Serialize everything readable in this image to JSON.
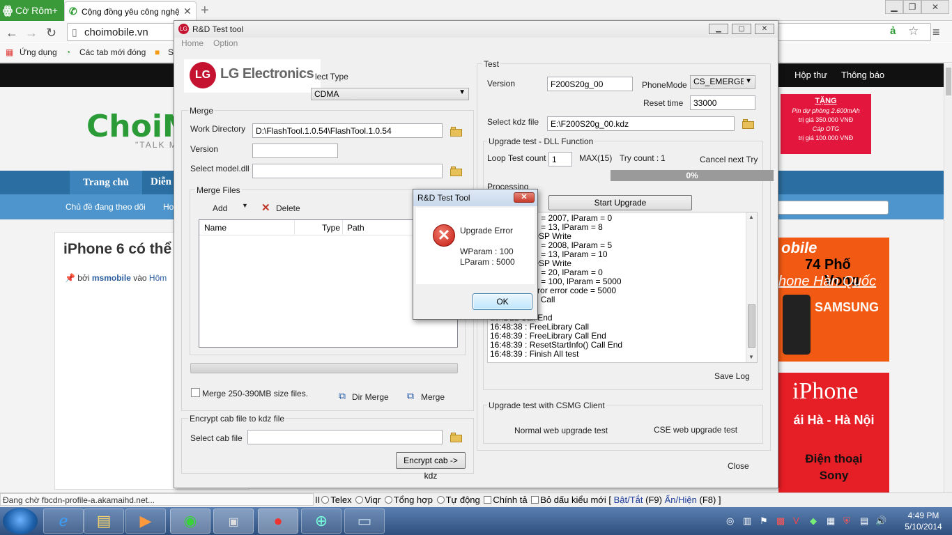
{
  "browser": {
    "brand": "Cờ Rôm+",
    "tab_title": "Cộng đồng yêu công nghệ",
    "url": "choimobile.vn",
    "bookmarks": [
      "Ứng dụng",
      "Các tab mới đóng",
      "S"
    ],
    "status": "Đang chờ fbcdn-profile-a.akamaihd.net..."
  },
  "site": {
    "topbar_links": [
      "Hộp thư",
      "Thông báo"
    ],
    "logo": "ChoiMob",
    "slogan": "\"TALK M",
    "ad_top": [
      "TẶNG",
      "Pin dự phòng 2.600mAh",
      "trị giá 350.000 VNĐ",
      "Cáp OTG",
      "trị giá 100.000 VNĐ"
    ],
    "nav_active": "Trang chủ",
    "nav_second": "Diễn",
    "subnav": [
      "Chủ đề đang theo dõi",
      "Ho"
    ],
    "post_title": "iPhone 6 có thể",
    "post_meta_prefix": "bởi",
    "post_author": "msmobile",
    "post_meta_mid": "vào",
    "post_meta_link": "Hôm",
    "ad_mid": [
      "obile",
      "74",
      "Phố Vọng",
      "hone Hàn Quốc",
      "SAMSUNG"
    ],
    "ad_low": [
      "iPhone",
      "ái Hà - Hà Nội",
      "Điện thoại",
      "Sony"
    ]
  },
  "ime": {
    "prefix": "II",
    "options": [
      "Telex",
      "Viqr",
      "Tổng hợp",
      "Tự động"
    ],
    "checks": [
      "Chính tả",
      "Bỏ dấu kiểu mới"
    ],
    "toggle_prefix": "[",
    "toggle": "Bật/Tắt",
    "toggle_key": "(F9)",
    "showhide": "Ẩn/Hiện",
    "showhide_key": "(F8) ]"
  },
  "taskbar": {
    "clock_time": "4:49 PM",
    "clock_date": "5/10/2014"
  },
  "tool": {
    "title": "R&D Test tool",
    "menu": [
      "Home",
      "Option"
    ],
    "logo_text": "LG Electronics",
    "select_type_label": "lect Type",
    "select_type_value": "CDMA",
    "merge": {
      "group": "Merge",
      "work_dir_label": "Work Directory",
      "work_dir_value": "D:\\FlashTool.1.0.54\\FlashTool.1.0.54",
      "version_label": "Version",
      "version_value": "",
      "model_label": "Select model.dll",
      "model_value": "",
      "files_group": "Merge Files",
      "add": "Add",
      "delete": "Delete",
      "columns": [
        "Name",
        "Type",
        "Path"
      ],
      "size_check": "Merge 250-390MB size files.",
      "dir_merge": "Dir Merge",
      "merge": "Merge"
    },
    "encrypt": {
      "group": "Encrypt cab file to kdz file",
      "cab_label": "Select cab file",
      "cab_value": "",
      "button": "Encrypt cab -> kdz"
    },
    "test": {
      "group": "Test",
      "version_label": "Version",
      "version_value": "F200S20g_00",
      "phonemode_label": "PhoneMode",
      "phonemode_value": "CS_EMERGEN",
      "reset_label": "Reset time",
      "reset_value": "33000",
      "kdz_label": "Select kdz file",
      "kdz_value": "E:\\F200S20g_00.kdz"
    },
    "dll": {
      "group": "Upgrade test - DLL Function",
      "loop_label": "Loop Test count",
      "loop_value": "1",
      "max": "MAX(15)",
      "try_label": "Try count :",
      "try_value": "1",
      "cancel_try": "Cancel next Try",
      "progress_pct": 0,
      "progress_text": "0%",
      "processing_label": "Processing",
      "start_button": "Start Upgrade",
      "log": [
        "CT : wParam = 2007, lParam = 0",
        "CT : wParam = 13, lParam = 8",
        "Complete : DSP Write",
        "CT : wParam = 2008, lParam = 5",
        "CT : wParam = 13, lParam = 10",
        "Complete : DSP Write",
        "CT : wParam = 20, lParam = 0",
        "CT : wParam = 100, lParam = 5000",
        ": Upgrade Error error code = 5000",
        "setStartInfo() Call",
        "achDLL Call",
        "achDLL Call End",
        "16:48:38 : FreeLibrary Call",
        "16:48:39 : FreeLibrary Call End",
        "16:48:39 : ResetStartInfo() Call End",
        "16:48:39 : Finish All test"
      ],
      "save_log": "Save Log"
    },
    "csmg": {
      "group": "Upgrade test with CSMG Client",
      "normal": "Normal web upgrade test",
      "cse": "CSE web upgrade test"
    },
    "close": "Close"
  },
  "dialog": {
    "title": "R&D Test Tool",
    "heading": "Upgrade Error",
    "wparam": "WParam : 100",
    "lparam": "LParam : 5000",
    "ok": "OK"
  }
}
